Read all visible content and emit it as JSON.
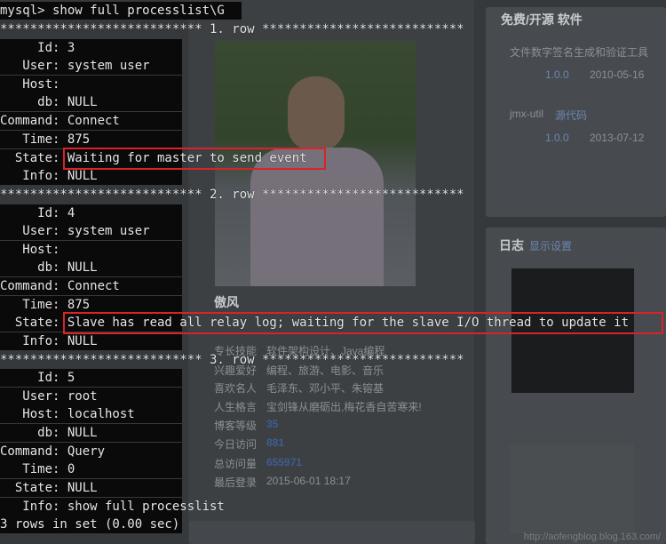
{
  "terminal": {
    "lines": [
      "mysql> show full processlist\\G",
      "*************************** 1. row ***************************",
      "     Id: 3",
      "   User: system user",
      "   Host:",
      "     db: NULL",
      "Command: Connect",
      "   Time: 875",
      "  State: Waiting for master to send event",
      "   Info: NULL",
      "*************************** 2. row ***************************",
      "     Id: 4",
      "   User: system user",
      "   Host:",
      "     db: NULL",
      "Command: Connect",
      "   Time: 875",
      "  State: Slave has read all relay log; waiting for the slave I/O thread to update it",
      "   Info: NULL",
      "*************************** 3. row ***************************",
      "     Id: 5",
      "   User: root",
      "   Host: localhost",
      "     db: NULL",
      "Command: Query",
      "   Time: 0",
      "  State: NULL",
      "   Info: show full processlist",
      "3 rows in set (0.00 sec)"
    ]
  },
  "background_page": {
    "right_col": {
      "software_heading": "免费/开源 软件",
      "item1_name": "文件数字签名生成和验证工具",
      "item1_version": "1.0.0",
      "item1_date": "2010-05-16",
      "item2_name": "jmx-util",
      "item2_link": "源代码",
      "item2_version": "1.0.0",
      "item2_date": "2013-07-12",
      "log_heading": "日志",
      "log_link": "显示设置"
    },
    "profile": {
      "name": "傲风",
      "skills_label": "专长技能",
      "skills_value": "软件架构设计、Java编程",
      "hobby_label": "兴趣爱好",
      "hobby_value": "编程、旅游、电影、音乐",
      "people_label": "喜欢名人",
      "people_value": "毛泽东、邓小平、朱镕基",
      "motto_label": "人生格言",
      "motto_value": "宝剑锋从磨砺出,梅花香自苦寒来!",
      "posts_label": "博客等级",
      "posts_value": "35",
      "today_label": "今日访问",
      "today_value": "881",
      "total_label": "总访问量",
      "total_value": "655971",
      "last_label": "最后登录",
      "last_value": "2015-06-01 18:17"
    },
    "watermark": "http://aofengblog.blog.163.com/"
  },
  "colors": {
    "highlight_box": "#d8232a",
    "terminal_text": "#e6e6e6",
    "terminal_bg": "#0a0a0a"
  }
}
